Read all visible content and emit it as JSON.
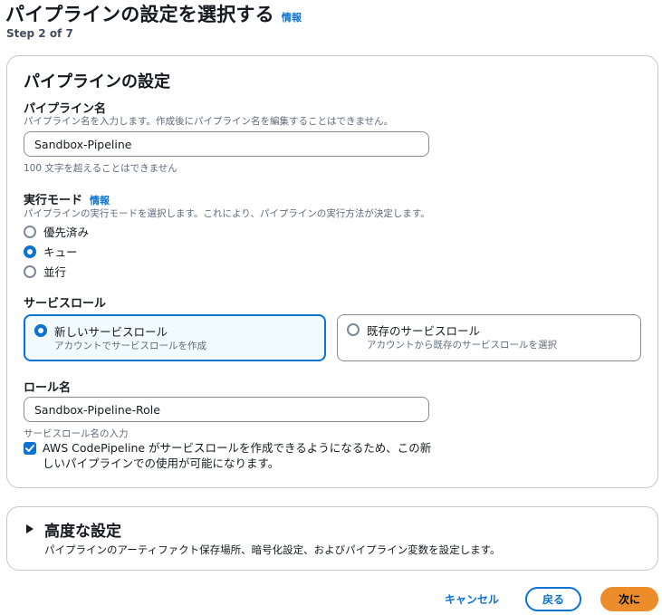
{
  "header": {
    "title": "パイプラインの設定を選択する",
    "info": "情報",
    "step": "Step 2 of 7"
  },
  "pipeline_settings": {
    "title": "パイプラインの設定",
    "name": {
      "label": "パイプライン名",
      "description": "パイプライン名を入力します。作成後にパイプライン名を編集することはできません。",
      "value": "Sandbox-Pipeline",
      "constraint": "100 文字を超えることはできません"
    },
    "execution_mode": {
      "label": "実行モード",
      "info": "情報",
      "description": "パイプラインの実行モードを選択します。これにより、パイプラインの実行方法が決定します。",
      "options": [
        "優先済み",
        "キュー",
        "並行"
      ],
      "selected": "キュー"
    },
    "service_role": {
      "label": "サービスロール",
      "options": [
        {
          "title": "新しいサービスロール",
          "description": "アカウントでサービスロールを作成",
          "selected": true
        },
        {
          "title": "既存のサービスロール",
          "description": "アカウントから既存のサービスロールを選択",
          "selected": false
        }
      ]
    },
    "role_name": {
      "label": "ロール名",
      "value": "Sandbox-Pipeline-Role",
      "hint": "サービスロール名の入力",
      "checkbox_label": "AWS CodePipeline がサービスロールを作成できるようになるため、この新しいパイプラインでの使用が可能になります。",
      "checked": true
    }
  },
  "advanced": {
    "title": "高度な設定",
    "description": "パイプラインのアーティファクト保存場所、暗号化設定、およびパイプライン変数を設定します。"
  },
  "footer": {
    "cancel": "キャンセル",
    "back": "戻る",
    "next": "次に"
  },
  "colors": {
    "accent": "#0972d3",
    "primary_button": "#ec8c2a"
  }
}
